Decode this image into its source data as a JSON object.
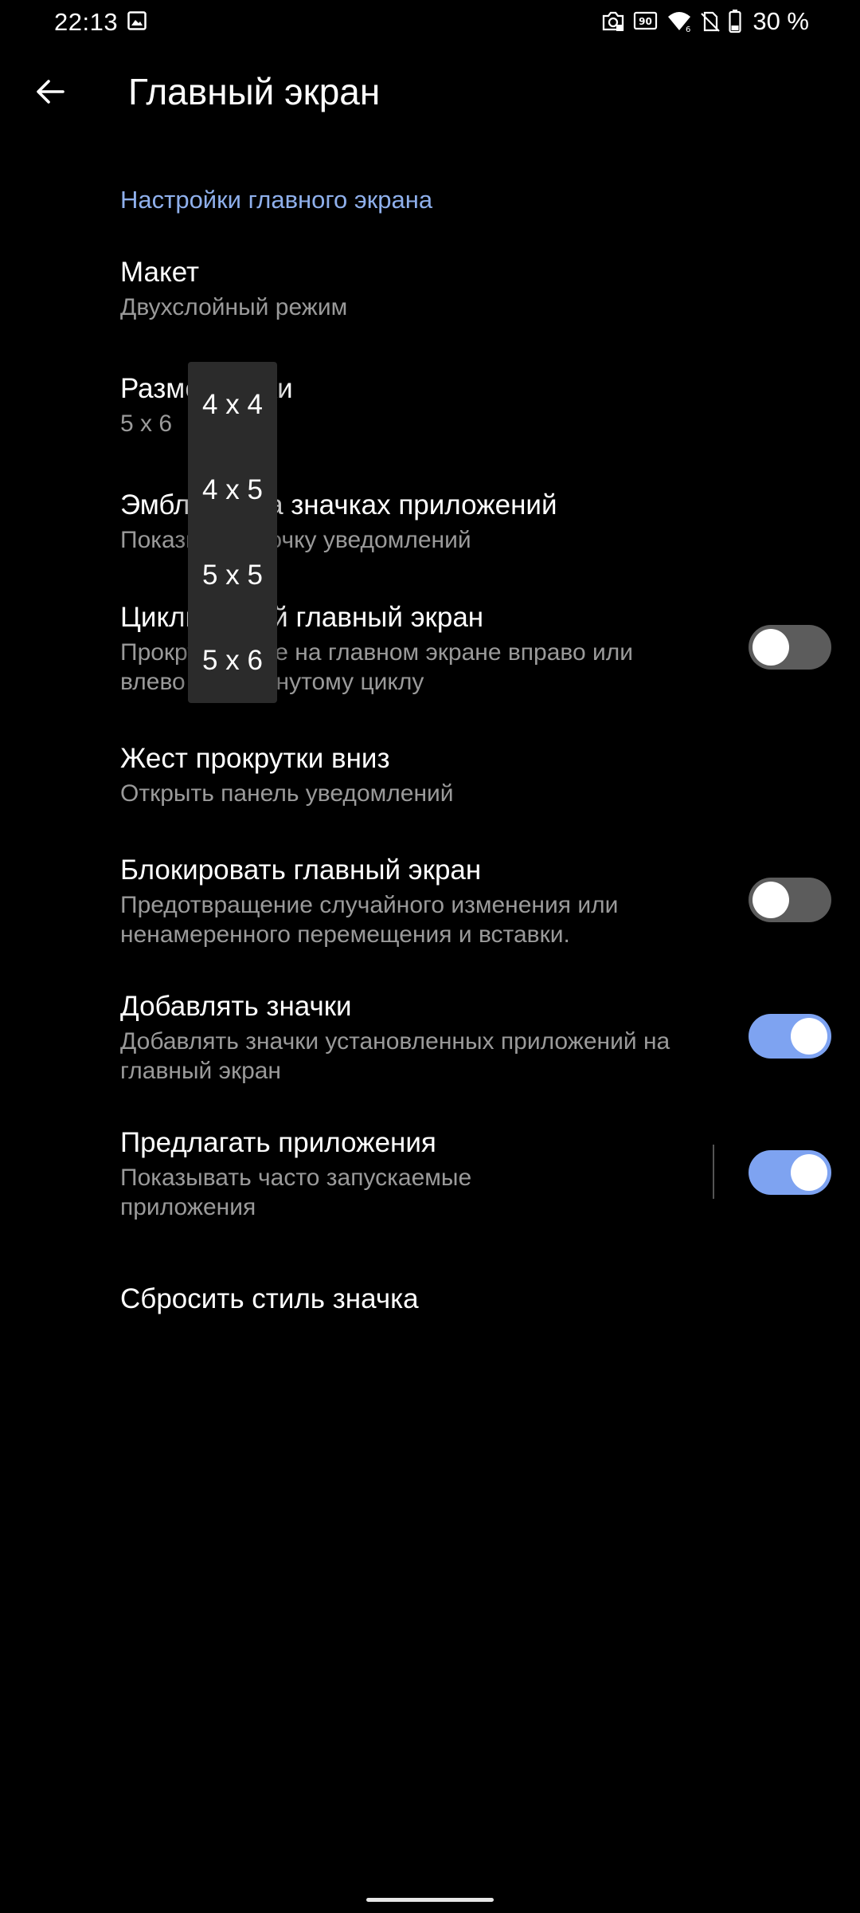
{
  "status_bar": {
    "time": "22:13",
    "battery": "30 %",
    "icons": [
      "gallery-icon",
      "screenshot-icon",
      "refresh-rate-icon",
      "wifi-icon",
      "no-sim-icon",
      "battery-icon"
    ],
    "refresh_rate": "90"
  },
  "header": {
    "title": "Главный экран",
    "back_icon": "arrow-back-icon"
  },
  "section": {
    "title": "Настройки главного экрана"
  },
  "settings": {
    "layout": {
      "title": "Макет",
      "summary": "Двухслойный режим"
    },
    "grid": {
      "title": "Размер сетки",
      "summary": "5 x 6"
    },
    "badges": {
      "title": "Эмблемы на значках приложений",
      "summary": "Показывать точку уведомлений"
    },
    "loop": {
      "title": "Циклический главный экран",
      "summary": "Прокручивайте на главном экране вправо или влево по замкнутому циклу",
      "enabled": false
    },
    "swipe_down": {
      "title": "Жест прокрутки вниз",
      "summary": "Открыть панель уведомлений"
    },
    "lock": {
      "title": "Блокировать главный экран",
      "summary": "Предотвращение случайного изменения или ненамеренного перемещения и вставки.",
      "enabled": false
    },
    "add_icons": {
      "title": "Добавлять значки",
      "summary": "Добавлять значки установленных приложений на главный экран",
      "enabled": true
    },
    "suggest_apps": {
      "title": "Предлагать приложения",
      "summary": "Показывать часто запускаемые приложения",
      "enabled": true
    },
    "reset_icon_style": {
      "title": "Сбросить стиль значка"
    }
  },
  "grid_dropdown": {
    "options": [
      "4 x 4",
      "4 x 5",
      "5 x 5",
      "5 x 6"
    ],
    "selected": "5 x 6"
  },
  "colors": {
    "background": "#000000",
    "accent": "#8fb0ec",
    "toggle_on": "#7ea3f1",
    "toggle_off": "#5c5c5c",
    "summary_text": "#9a9a9a",
    "popup_bg": "#2b2b2b"
  }
}
